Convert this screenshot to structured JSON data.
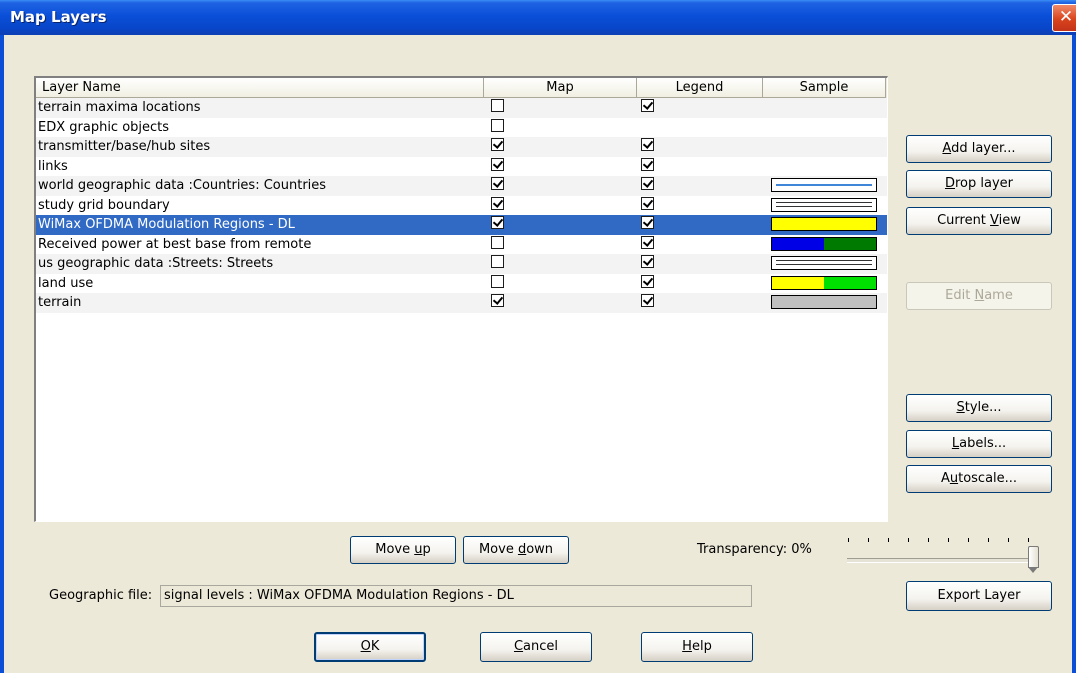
{
  "window": {
    "title": "Map Layers",
    "close_glyph": "✕"
  },
  "columns": {
    "name": "Layer Name",
    "map": "Map",
    "legend": "Legend",
    "sample": "Sample"
  },
  "layers": [
    {
      "name": "terrain maxima locations",
      "map": false,
      "legend": true,
      "sample": "none"
    },
    {
      "name": "EDX graphic objects",
      "map": false,
      "legend": null,
      "sample": "none"
    },
    {
      "name": "transmitter/base/hub sites",
      "map": true,
      "legend": true,
      "sample": "none"
    },
    {
      "name": "links",
      "map": true,
      "legend": true,
      "sample": "none"
    },
    {
      "name": "world geographic data :Countries: Countries",
      "map": true,
      "legend": true,
      "sample": "blue-line"
    },
    {
      "name": "study grid boundary",
      "map": true,
      "legend": true,
      "sample": "double-line"
    },
    {
      "name": "WiMax OFDMA Modulation Regions - DL",
      "map": true,
      "legend": true,
      "sample": "solid",
      "colors": [
        "#ffff00",
        "#ffff00"
      ],
      "selected": true
    },
    {
      "name": "Received power at best base from remote",
      "map": false,
      "legend": true,
      "sample": "split",
      "colors": [
        "#0000e6",
        "#007a00"
      ]
    },
    {
      "name": "us geographic data :Streets: Streets",
      "map": false,
      "legend": true,
      "sample": "double-line"
    },
    {
      "name": "land use",
      "map": false,
      "legend": true,
      "sample": "split",
      "colors": [
        "#ffff00",
        "#00e000"
      ]
    },
    {
      "name": "terrain",
      "map": true,
      "legend": true,
      "sample": "split",
      "colors": [
        "#c0c0c0",
        "#c0c0c0"
      ]
    }
  ],
  "side_buttons": {
    "add_layer": {
      "pre": "",
      "u": "A",
      "post": "dd layer..."
    },
    "drop_layer": {
      "pre": "",
      "u": "D",
      "post": "rop layer"
    },
    "current_view": {
      "pre": "Current ",
      "u": "V",
      "post": "iew"
    },
    "edit_name": {
      "pre": "Edit ",
      "u": "N",
      "post": "ame"
    },
    "style": {
      "pre": "",
      "u": "S",
      "post": "tyle..."
    },
    "labels": {
      "pre": "",
      "u": "L",
      "post": "abels..."
    },
    "autoscale": {
      "pre": "A",
      "u": "u",
      "post": "toscale..."
    },
    "export_layer": {
      "pre": "Export Layer",
      "u": "",
      "post": ""
    }
  },
  "move_buttons": {
    "move_up": {
      "pre": "Move ",
      "u": "u",
      "post": "p"
    },
    "move_down": {
      "pre": "Move ",
      "u": "d",
      "post": "own"
    }
  },
  "transparency": {
    "label": "Transparency: 0%",
    "value_percent": 0
  },
  "geographic_file": {
    "label": "Geographic file:",
    "value": "signal levels : WiMax OFDMA Modulation Regions - DL"
  },
  "bottom_buttons": {
    "ok": {
      "pre": "",
      "u": "O",
      "post": "K"
    },
    "cancel": {
      "pre": "",
      "u": "C",
      "post": "ancel"
    },
    "help": {
      "pre": "",
      "u": "H",
      "post": "elp"
    }
  }
}
